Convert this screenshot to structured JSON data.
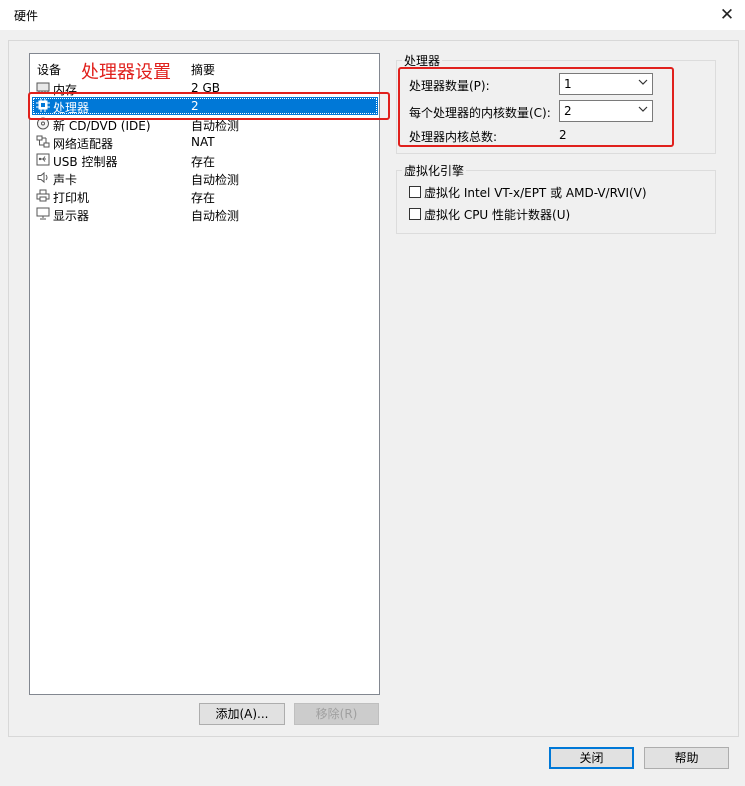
{
  "window": {
    "title": "硬件",
    "close_glyph": "✕"
  },
  "device_list": {
    "header_device": "设备",
    "header_summary": "摘要",
    "annotation": "处理器设置",
    "items": [
      {
        "name": "内存",
        "summary": "2 GB",
        "icon": "memory-icon",
        "selected": false
      },
      {
        "name": "处理器",
        "summary": "2",
        "icon": "cpu-icon",
        "selected": true
      },
      {
        "name": "新 CD/DVD (IDE)",
        "summary": "自动检测",
        "icon": "cd-icon",
        "selected": false
      },
      {
        "name": "网络适配器",
        "summary": "NAT",
        "icon": "network-icon",
        "selected": false
      },
      {
        "name": "USB 控制器",
        "summary": "存在",
        "icon": "usb-icon",
        "selected": false
      },
      {
        "name": "声卡",
        "summary": "自动检测",
        "icon": "speaker-icon",
        "selected": false
      },
      {
        "name": "打印机",
        "summary": "存在",
        "icon": "printer-icon",
        "selected": false
      },
      {
        "name": "显示器",
        "summary": "自动检测",
        "icon": "monitor-icon",
        "selected": false
      }
    ],
    "add_button": "添加(A)...",
    "remove_button": "移除(R)"
  },
  "processor_group": {
    "title": "处理器",
    "count_label": "处理器数量(P):",
    "count_value": "1",
    "cores_label": "每个处理器的内核数量(C):",
    "cores_value": "2",
    "total_label": "处理器内核总数:",
    "total_value": "2"
  },
  "virtualization_group": {
    "title": "虚拟化引擎",
    "vtx_label": "虚拟化 Intel VT-x/EPT 或 AMD-V/RVI(V)",
    "vtx_checked": false,
    "perf_label": "虚拟化 CPU 性能计数器(U)",
    "perf_checked": false
  },
  "footer": {
    "close_button": "关闭",
    "help_button": "帮助"
  },
  "colors": {
    "selection": "#0078d7",
    "annotation_red": "#e0201c"
  }
}
